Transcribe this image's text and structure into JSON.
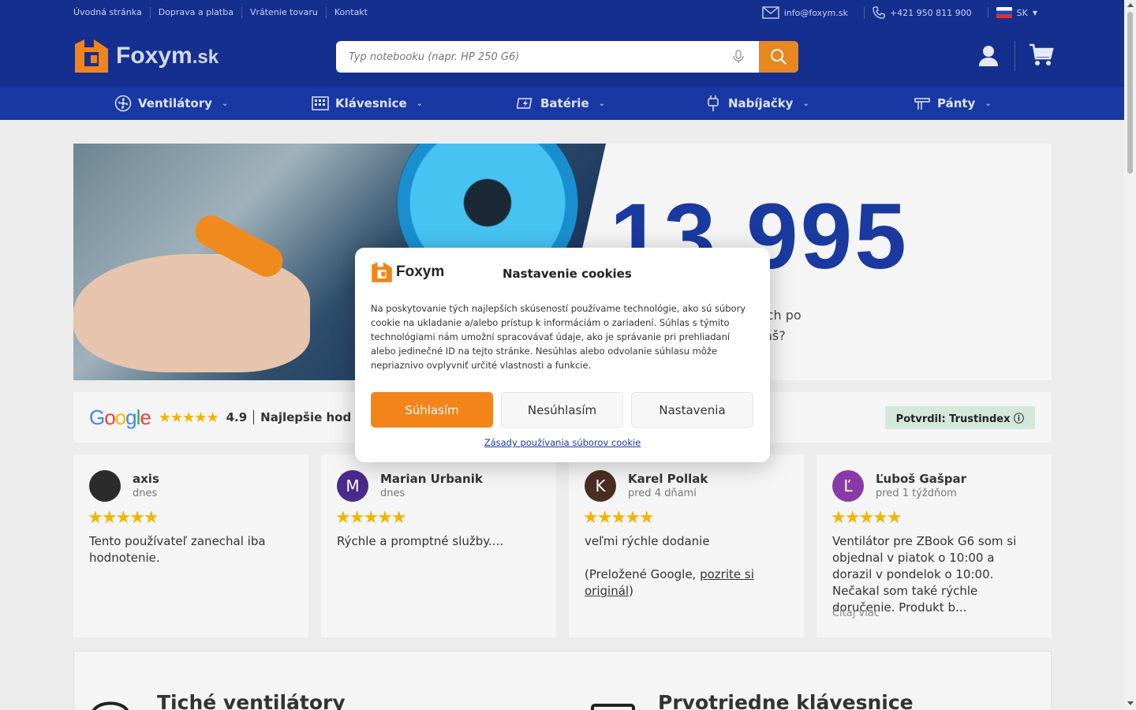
{
  "topbar": {
    "links": [
      "Úvodná stránka",
      "Doprava a platba",
      "Vrátenie tovaru",
      "Kontakt"
    ],
    "email": "info@foxym.sk",
    "phone": "+421 950 811 900",
    "lang": "SK"
  },
  "header": {
    "logo_main": "Foxym",
    "logo_suffix": ".sk",
    "search_placeholder": "Typ notebooku (napr. HP 250 G6)"
  },
  "nav": {
    "items": [
      {
        "label": "Ventilátory",
        "icon": "fan-icon"
      },
      {
        "label": "Klávesnice",
        "icon": "keyboard-icon"
      },
      {
        "label": "Batérie",
        "icon": "battery-icon"
      },
      {
        "label": "Nabíjačky",
        "icon": "charger-icon"
      },
      {
        "label": "Pánty",
        "icon": "hinge-icon"
      }
    ]
  },
  "hero": {
    "number": "13,995",
    "text": "ú už v 13,995 notebookoch po\nmôžeme opraviť aj ten Váš?"
  },
  "reviews_bar": {
    "brand": "Google",
    "rating": "4.9",
    "label": "Najlepšie hod",
    "verified": "Potvrdil: Trustindex"
  },
  "reviews": [
    {
      "name": "axis",
      "when": "dnes",
      "text": "Tento používateľ zanechal iba hodnotenie.",
      "initial": "",
      "color": "#2b2b2b"
    },
    {
      "name": "Marian Urbanik",
      "when": "dnes",
      "text": "Rýchle a promptné služby....",
      "initial": "M",
      "color": "#4a2a8a"
    },
    {
      "name": "Karel Pollak",
      "when": "pred 4 dňami",
      "text": "veľmi rýchle dodanie",
      "translated_prefix": "(Preložené Google, ",
      "translated_link": "pozrite si originál",
      "translated_suffix": ")",
      "initial": "K",
      "color": "#4a2e22"
    },
    {
      "name": "Ľuboš Gašpar",
      "when": "pred 1 týždňom",
      "text": "Ventilátor pre ZBook G6 som si objednal v piatok o 10:00 a dorazil v pondelok o 10:00. Nečakal som také rýchle doručenie. Produkt b...",
      "more": "Čítaj viac",
      "initial": "Ľ",
      "color": "#8a3aa8"
    }
  ],
  "features": {
    "left_title": "Tiché ventilátory",
    "right_title": "Prvotriedne klávesnice"
  },
  "cookie_dialog": {
    "logo": "Foxym",
    "title": "Nastavenie cookies",
    "body": "Na poskytovanie tých najlepších skúseností používame technológie, ako sú súbory cookie na ukladanie a/alebo prístup k informáciám o zariadení. Súhlas s týmito technológiami nám umožní spracovávať údaje, ako je správanie pri prehliadaní alebo jedinečné ID na tejto stránke. Nesúhlas alebo odvolanie súhlasu môže nepriaznivo ovplyvniť určité vlastnosti a funkcie.",
    "accept": "Súhlasím",
    "deny": "Nesúhlasím",
    "settings": "Nastavenia",
    "policy_link": "Zásady používania súborov cookie"
  },
  "colors": {
    "header": "#152f8f",
    "nav": "#1a38a3",
    "accent": "#f2841a",
    "trust_bg": "#d3e8d9"
  }
}
